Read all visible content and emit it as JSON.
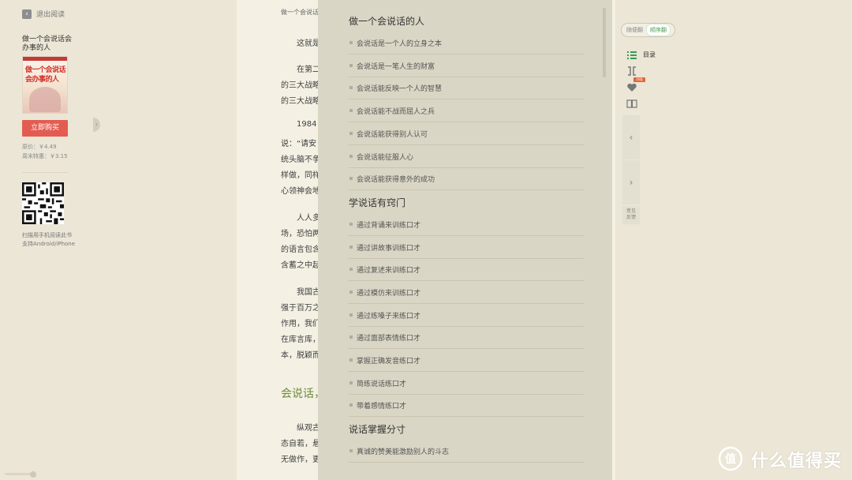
{
  "left": {
    "exit_label": "退出阅读",
    "book_title": "做一个会说话会办事的人",
    "cover": {
      "line1": "做一个会说话",
      "line2": "会办事的人"
    },
    "buy_label": "立即购买",
    "price_original": "原价：￥4.49",
    "price_weekend": "周末特惠：￥3.15",
    "qr_text1": "扫描用手机阅读此书",
    "qr_text2": "支持Android/iPhone"
  },
  "reader": {
    "header": "做一个会说话",
    "paragraphs": [
      "这就是",
      "在第二",
      "的三大战略",
      "的三大战略",
      "1984",
      "说：“请安",
      "统头脑不争",
      "样做，同样",
      "心领神会地",
      "人人多",
      "场，恐怕两",
      "的语言包含",
      "含蓄之中起",
      "我国古",
      "强于百万之",
      "作用，我们",
      "在库言库，",
      "本，脱颖而",
      "纵观古",
      "态自若，悬",
      "无做作，更"
    ],
    "section_heading": "会说话，"
  },
  "toc": {
    "chapters": [
      {
        "title": "做一个会说话的人",
        "items": [
          "会说话是一个人的立身之本",
          "会说话是一笔人生的财富",
          "会说话能反映一个人的智慧",
          "会说话能不战而屈人之兵",
          "会说话能获得别人认可",
          "会说话能征服人心",
          "会说话能获得意外的成功"
        ]
      },
      {
        "title": "学说话有窍门",
        "items": [
          "通过背诵来训练口才",
          "通过讲故事训练口才",
          "通过复述来训练口才",
          "通过模仿来训练口才",
          "通过练嗓子来练口才",
          "通过面部表情练口才",
          "掌握正确发音练口才",
          "简练说话练口才",
          "带着感情练口才"
        ]
      },
      {
        "title": "说话掌握分寸",
        "items": [
          "真诚的赞美能激励别人的斗志"
        ]
      }
    ]
  },
  "controls": {
    "mode_options": [
      "随便翻",
      "顺序翻"
    ],
    "toc_label": "目录",
    "badge": "16条",
    "feedback_line1": "意见",
    "feedback_line2": "反馈"
  },
  "watermark": {
    "text": "什么值得买"
  },
  "colors": {
    "accent_green": "#4a9d54",
    "buy_red": "#e35c52",
    "heading_green": "#6d8a3f"
  }
}
